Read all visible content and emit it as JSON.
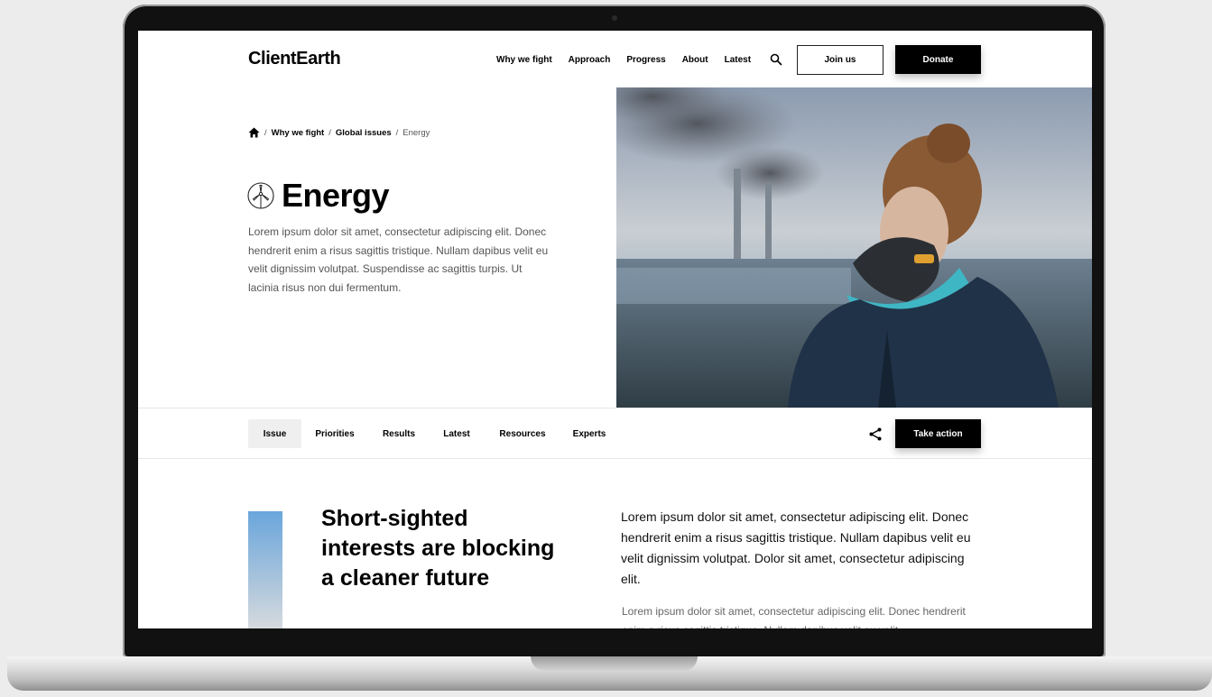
{
  "header": {
    "logo": "ClientEarth",
    "nav": [
      "Why we fight",
      "Approach",
      "Progress",
      "About",
      "Latest"
    ],
    "search_icon": "search-icon",
    "join_label": "Join us",
    "donate_label": "Donate"
  },
  "breadcrumb": {
    "home_icon": "home-icon",
    "sep1": "/",
    "item1": "Why we fight",
    "sep2": "/",
    "item2": "Global issues",
    "sep3": "/",
    "current": "Energy"
  },
  "hero": {
    "title_icon": "wind-turbine-icon",
    "title": "Energy",
    "intro": "Lorem ipsum dolor sit amet, consectetur adipiscing elit. Donec hendrerit enim a risus sagittis tristique. Nullam dapibus velit eu velit dignissim volutpat. Suspendisse ac sagittis turpis. Ut lacinia risus non dui fermentum."
  },
  "tabs": {
    "items": [
      "Issue",
      "Priorities",
      "Results",
      "Latest",
      "Resources",
      "Experts"
    ],
    "active": "Issue",
    "share_icon": "share-icon",
    "action_label": "Take action"
  },
  "section": {
    "heading": "Short-sighted interests are blocking a cleaner future",
    "lead": "Lorem ipsum dolor sit amet, consectetur adipiscing elit. Donec hendrerit enim a risus sagittis tristique. Nullam dapibus velit eu velit dignissim volutpat. Dolor sit amet, consectetur adipiscing elit.",
    "body": "Lorem ipsum dolor sit amet, consectetur adipiscing elit. Donec hendrerit enim a risus sagittis tristique. Nullam dapibus velit eu velit"
  },
  "colors": {
    "accent": "#000000",
    "tab_active_bg": "#efefef",
    "gradient_top": "#6aa6dc",
    "gradient_bottom": "#dedede"
  }
}
